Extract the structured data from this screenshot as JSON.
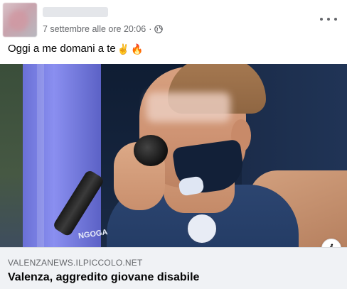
{
  "header": {
    "author_name": "",
    "timestamp": "7 settembre alle ore 20:06",
    "separator": "·",
    "privacy_icon": "globe-icon",
    "more_icon": "more-horizontal-icon"
  },
  "post": {
    "text": "Oggi a me domani a te",
    "emojis": [
      "✌",
      "🔥"
    ]
  },
  "link_preview": {
    "image_desc_icon": "info-icon",
    "info_label": "i",
    "domain": "VALENZANEWS.ILPICCOLO.NET",
    "title": "Valenza, aggredito giovane disabile",
    "badge_text": "NGOGA"
  },
  "colors": {
    "secondary_text": "#65676b",
    "primary_text": "#050505",
    "link_bg": "#f0f2f5"
  }
}
